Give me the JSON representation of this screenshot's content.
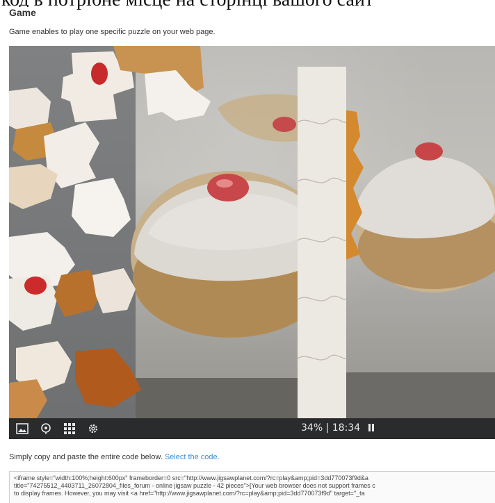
{
  "heading_fragment": "код в потрібне місце на сторінці вашого сайт",
  "section": {
    "title": "Game",
    "description": "Game enables to play one specific puzzle on your web page."
  },
  "game": {
    "progress_percent": 34,
    "progress_text": "34%",
    "separator": "|",
    "timer": "18:34",
    "toolbar_icons": [
      "image-preview-icon",
      "ghost-image-icon",
      "pieces-grid-icon",
      "settings-gear-icon"
    ]
  },
  "copy_instruction": {
    "text": "Simply copy and paste the entire code below.",
    "link": "Select the code."
  },
  "embed_code": "<iframe style=\"width:100%;height:600px\" frameborder=0 src=\"http://www.jigsawplanet.com/?rc=play&amp;pid=3dd770073f9d&a\ntitle=\"74275512_4403711_26072804_files_forum - online jigsaw puzzle - 42 pieces\">[Your web browser does not support frames c\nto display frames. However, you may visit <a href=\"http://www.jigsawplanet.com/?rc=play&amp;pid=3dd770073f9d\" target=\"_ta",
  "colors": {
    "toolbar_bg": "#2a2b2c",
    "link": "#3b8fd4",
    "board_bg": "#7a7c7d"
  }
}
